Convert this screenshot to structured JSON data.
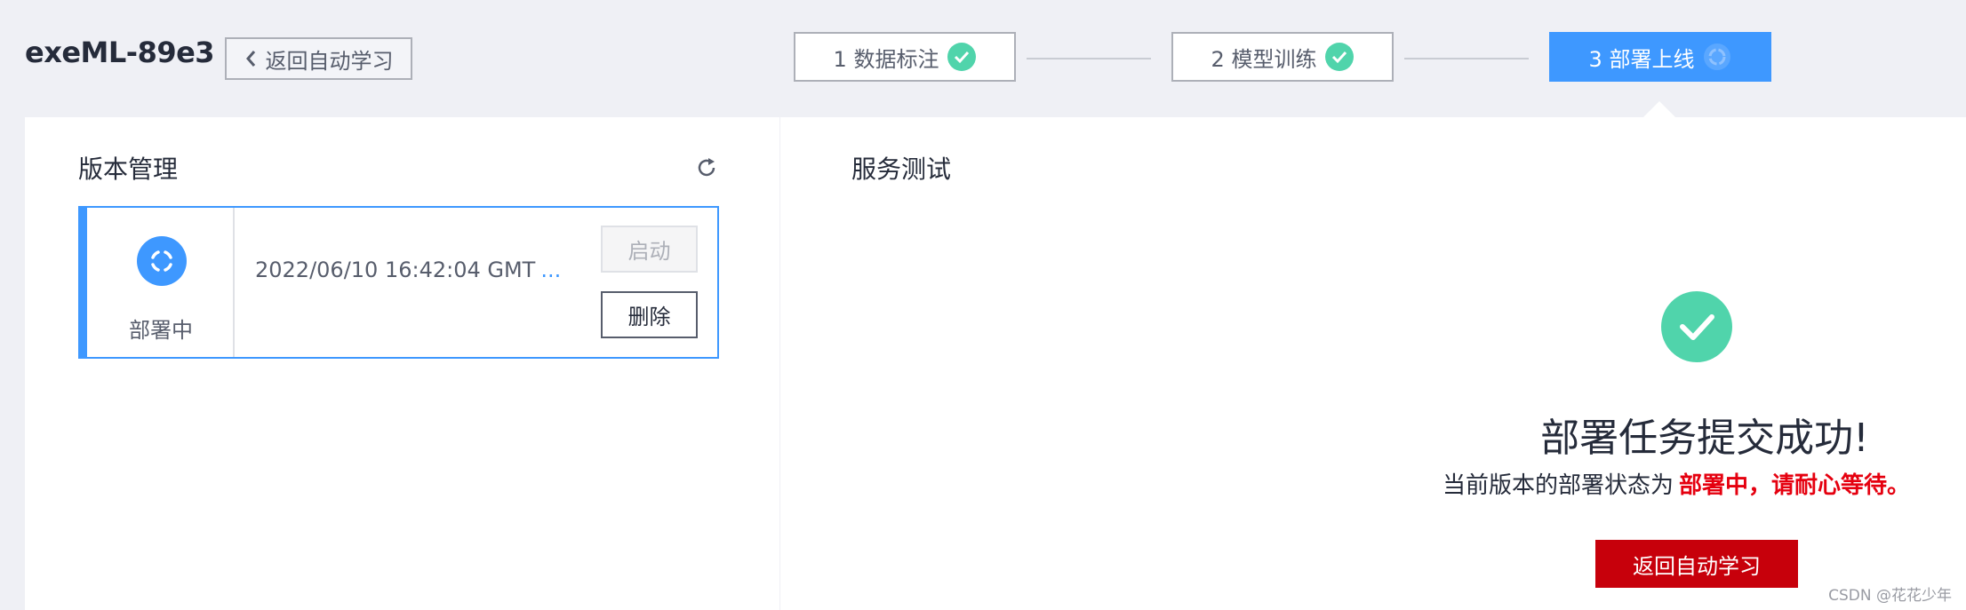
{
  "header": {
    "app_title": "exeML-89e3",
    "back_label": "返回自动学习"
  },
  "steps": [
    {
      "label": "1 数据标注",
      "status": "done"
    },
    {
      "label": "2 模型训练",
      "status": "done"
    },
    {
      "label": "3 部署上线",
      "status": "active"
    }
  ],
  "versions": {
    "title": "版本管理",
    "card": {
      "status": "部署中",
      "time": "2022/06/10 16:42:04 GMT",
      "more": "...",
      "start_label": "启动",
      "delete_label": "删除"
    }
  },
  "service": {
    "title": "服务测试",
    "success_title": "部署任务提交成功!",
    "desc_prefix": "当前版本的部署状态为",
    "desc_highlight": "部署中，请耐心等待。",
    "return_label": "返回自动学习"
  },
  "watermark": "CSDN @花花少年",
  "colors": {
    "accent": "#3e98ff",
    "success": "#50d4ab",
    "primary": "#c7000b",
    "highlight": "#e5000f"
  }
}
